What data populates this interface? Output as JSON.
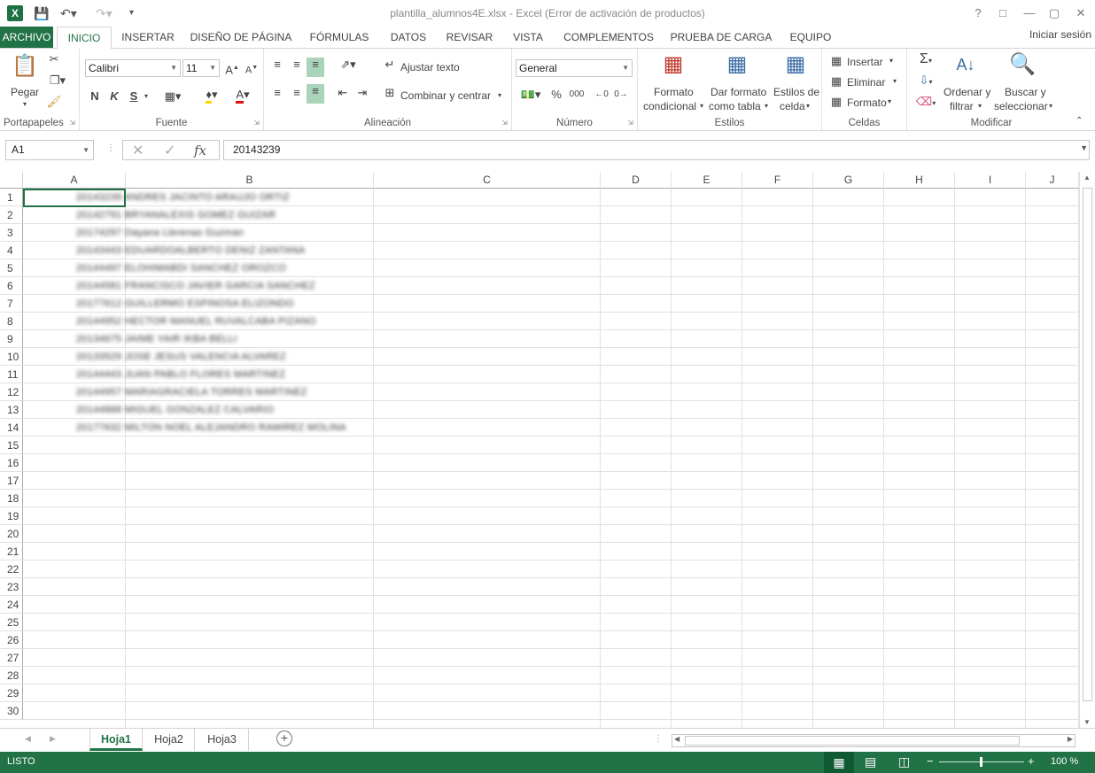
{
  "window": {
    "title": "plantilla_alumnos4E.xlsx - Excel (Error de activación de productos)",
    "signin": "Iniciar sesión"
  },
  "tabs": [
    "ARCHIVO",
    "INICIO",
    "INSERTAR",
    "DISEÑO DE PÁGINA",
    "FÓRMULAS",
    "DATOS",
    "REVISAR",
    "VISTA",
    "COMPLEMENTOS",
    "PRUEBA DE CARGA",
    "EQUIPO"
  ],
  "ribbon": {
    "portapapeles": {
      "label": "Portapapeles",
      "paste": "Pegar"
    },
    "fuente": {
      "label": "Fuente",
      "font": "Calibri",
      "size": "11",
      "bold": "N",
      "italic": "K",
      "underline": "S"
    },
    "alineacion": {
      "label": "Alineación",
      "wrap": "Ajustar texto",
      "merge": "Combinar y centrar"
    },
    "numero": {
      "label": "Número",
      "format": "General"
    },
    "estilos": {
      "label": "Estilos",
      "cond1": "Formato",
      "cond2": "condicional",
      "table1": "Dar formato",
      "table2": "como tabla",
      "cell1": "Estilos de",
      "cell2": "celda"
    },
    "celdas": {
      "label": "Celdas",
      "insert": "Insertar",
      "delete": "Eliminar",
      "format": "Formato"
    },
    "modificar": {
      "label": "Modificar",
      "sort1": "Ordenar y",
      "sort2": "filtrar",
      "find1": "Buscar y",
      "find2": "seleccionar"
    }
  },
  "formula_bar": {
    "namebox": "A1",
    "value": "20143239"
  },
  "columns": [
    "A",
    "B",
    "C",
    "D",
    "E",
    "F",
    "G",
    "H",
    "I",
    "J"
  ],
  "rows": [
    "1",
    "2",
    "3",
    "4",
    "5",
    "6",
    "7",
    "8",
    "9",
    "10",
    "11",
    "12",
    "13",
    "14",
    "15",
    "16",
    "17",
    "18",
    "19",
    "20",
    "21",
    "22",
    "23",
    "24",
    "25",
    "26",
    "27",
    "28",
    "29",
    "30"
  ],
  "cells": [
    "20143239 ANDRES JACINTO ARAUJO ORTIZ",
    "20142791 BRYANALEXIS GOMEZ GUIZAR",
    "20174297 Dayana Llerenas Guzman",
    "20143443 EDUARDOALBERTO DENIZ ZANTANA",
    "20144497 ELOHIMABDI SANCHEZ OROZCO",
    "20144581 FRANCISCO JAVIER GARCIA SANCHEZ",
    "20177612 GUILLERMO ESPINOSA ELIZONDO",
    "20144952 HECTOR MANUEL RUVALCABA PIZANO",
    "20134675 JAIME YAIR IKBA BELLI",
    "20133529 JOSE JESUS VALENCIA ALVAREZ",
    "20144443 JUAN PABLO FLORES MARTINEZ",
    "20144957 MARIAGRACIELA TORRES MARTINEZ",
    "20144888 MIGUEL GONZALEZ CALVARIO",
    "20177632 MILTON NOEL ALEJANDRO RAMIREZ MOLINA"
  ],
  "sheets": [
    "Hoja1",
    "Hoja2",
    "Hoja3"
  ],
  "status": {
    "mode": "LISTO",
    "zoom": "100 %"
  }
}
